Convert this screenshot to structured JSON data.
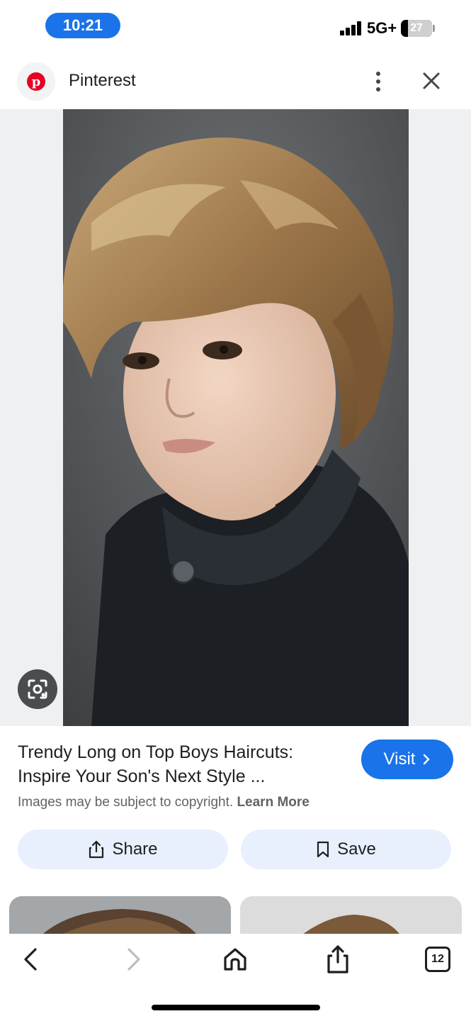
{
  "status_bar": {
    "time": "10:21",
    "network": "5G+",
    "battery": "27"
  },
  "source": {
    "name": "Pinterest",
    "logo_letter": "p",
    "icons": [
      "more-vert-icon",
      "close-icon"
    ]
  },
  "image": {
    "lens_icon": "google-lens-icon"
  },
  "result": {
    "title": "Trendy Long on Top Boys Haircuts: Inspire Your Son's Next Style ...",
    "visit_label": "Visit",
    "copyright_text": "Images may be subject to copyright.",
    "learn_more": "Learn More"
  },
  "actions": {
    "share_label": "Share",
    "save_label": "Save"
  },
  "toolbar": {
    "tab_count": "12",
    "icons": [
      "back-icon",
      "forward-icon",
      "home-icon",
      "share-icon",
      "tabs-icon"
    ]
  },
  "colors": {
    "accent": "#1a73e8",
    "chip_bg": "#e8f0fe",
    "pinterest_red": "#e60023"
  }
}
